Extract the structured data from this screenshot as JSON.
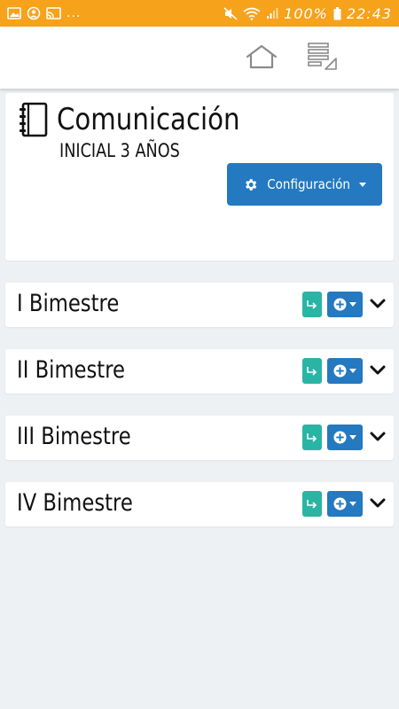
{
  "status_bar": {
    "dots": "...",
    "battery": "100%",
    "time": "22:43"
  },
  "header": {
    "icons": [
      "home-icon",
      "menu-icon"
    ]
  },
  "course": {
    "title": "Comunicación",
    "subtitle": "INICIAL 3 AÑOS",
    "config_label": "Configuración",
    "icon": "notebook-icon"
  },
  "bimestres": [
    {
      "label": "I Bimestre"
    },
    {
      "label": "II Bimestre"
    },
    {
      "label": "III Bimestre"
    },
    {
      "label": "IV Bimestre"
    }
  ],
  "colors": {
    "status_bar": "#f7a21b",
    "primary": "#2479c0",
    "teal": "#2ab4a4",
    "background": "#eef1f3"
  }
}
